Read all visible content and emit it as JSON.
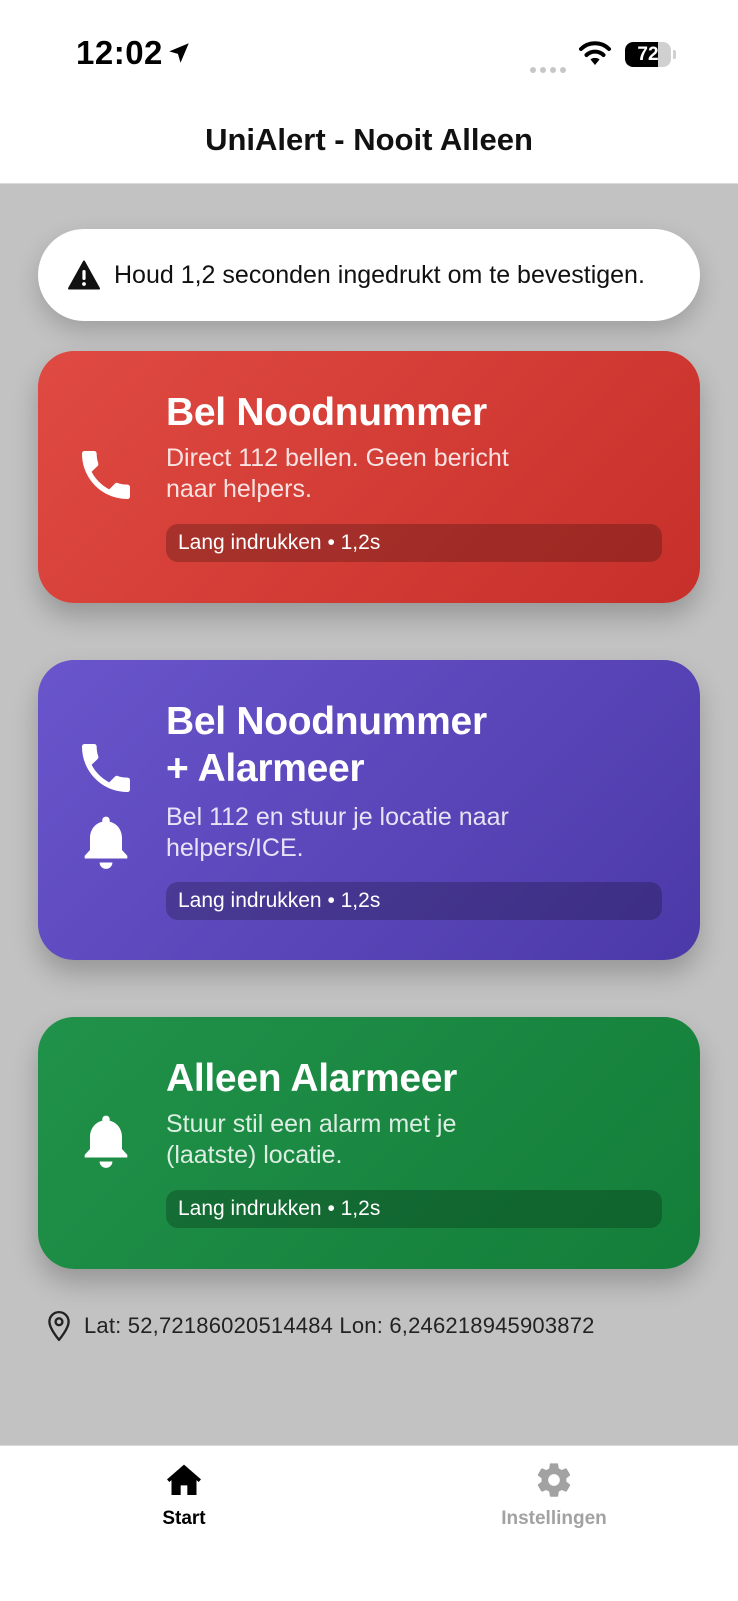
{
  "status_bar": {
    "time": "12:02",
    "battery_level": "72",
    "battery_fraction": 0.72
  },
  "header": {
    "title": "UniAlert - Nooit Alleen"
  },
  "hint": {
    "icon": "warning-icon",
    "text": "Houd 1,2 seconden ingedrukt om te bevestigen."
  },
  "cards": [
    {
      "icons": [
        "phone-icon"
      ],
      "title_line1": "Bel Noodnummer",
      "desc_line1": "Direct 112 bellen. Geen bericht",
      "desc_line2": "naar helpers.",
      "pill": "Lang indrukken • 1,2s",
      "color": "#d63c35"
    },
    {
      "icons": [
        "phone-icon",
        "bell-icon"
      ],
      "title_line1": "Bel Noodnummer",
      "title_line2": "+ Alarmeer",
      "desc_line1": "Bel 112 en stuur je locatie naar",
      "desc_line2": "helpers/ICE.",
      "pill": "Lang indrukken • 1,2s",
      "color": "#5b47bb"
    },
    {
      "icons": [
        "bell-icon"
      ],
      "title_line1": "Alleen Alarmeer",
      "desc_line1": "Stuur stil een alarm met je",
      "desc_line2": "(laatste) locatie.",
      "pill": "Lang indrukken • 1,2s",
      "color": "#1a8842"
    }
  ],
  "location": {
    "icon": "location-pin-icon",
    "text": "Lat: 52,72186020514484 Lon: 6,246218945903872"
  },
  "tabs": [
    {
      "icon": "home-icon",
      "label": "Start",
      "active": true
    },
    {
      "icon": "gear-icon",
      "label": "Instellingen",
      "active": false
    }
  ],
  "colors": {
    "background": "#c2c2c2",
    "tab_active": "#000000",
    "tab_inactive": "#a2a2a2"
  }
}
